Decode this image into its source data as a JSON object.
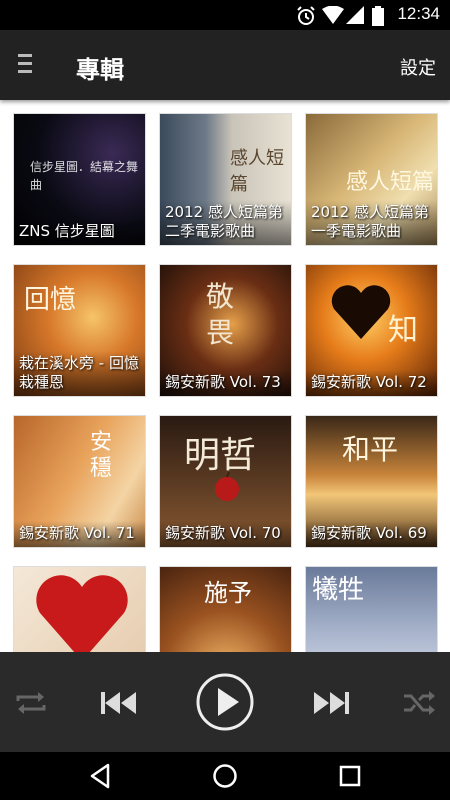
{
  "status_bar": {
    "time": "12:34",
    "icons": [
      "alarm-icon",
      "wifi-icon",
      "cellular-icon",
      "battery-icon"
    ]
  },
  "app_bar": {
    "menu_icon": "hamburger-icon",
    "title": "專輯",
    "settings_label": "設定"
  },
  "albums": [
    {
      "caption": "ZNS 信步星圖",
      "art_text": "信步星圖．結幕之舞曲"
    },
    {
      "caption": "2012 感人短篇第二季電影歌曲",
      "art_text": "感人短篇"
    },
    {
      "caption": "2012 感人短篇第一季電影歌曲",
      "art_text": "感人短篇"
    },
    {
      "caption": "栽在溪水旁 - 回憶栽種恩",
      "art_text": "回憶"
    },
    {
      "caption": "錫安新歌 Vol. 73",
      "art_text": "敬畏"
    },
    {
      "caption": "錫安新歌 Vol. 72",
      "art_text": "知"
    },
    {
      "caption": "錫安新歌 Vol. 71",
      "art_text": "安穩"
    },
    {
      "caption": "錫安新歌 Vol. 70",
      "art_text": "明哲"
    },
    {
      "caption": "錫安新歌 Vol. 69",
      "art_text": "和平"
    },
    {
      "caption": "",
      "art_text": ""
    },
    {
      "caption": "",
      "art_text": "施予"
    },
    {
      "caption": "",
      "art_text": "犧牲"
    }
  ],
  "player": {
    "controls": [
      "repeat-icon",
      "previous-icon",
      "play-icon",
      "next-icon",
      "shuffle-icon"
    ]
  },
  "nav_bar": {
    "buttons": [
      "back-icon",
      "home-icon",
      "recents-icon"
    ]
  },
  "colors": {
    "status_bar": "#000000",
    "app_bar": "#222222",
    "player_bar": "#2a2a2a",
    "nav_bar": "#000000"
  }
}
